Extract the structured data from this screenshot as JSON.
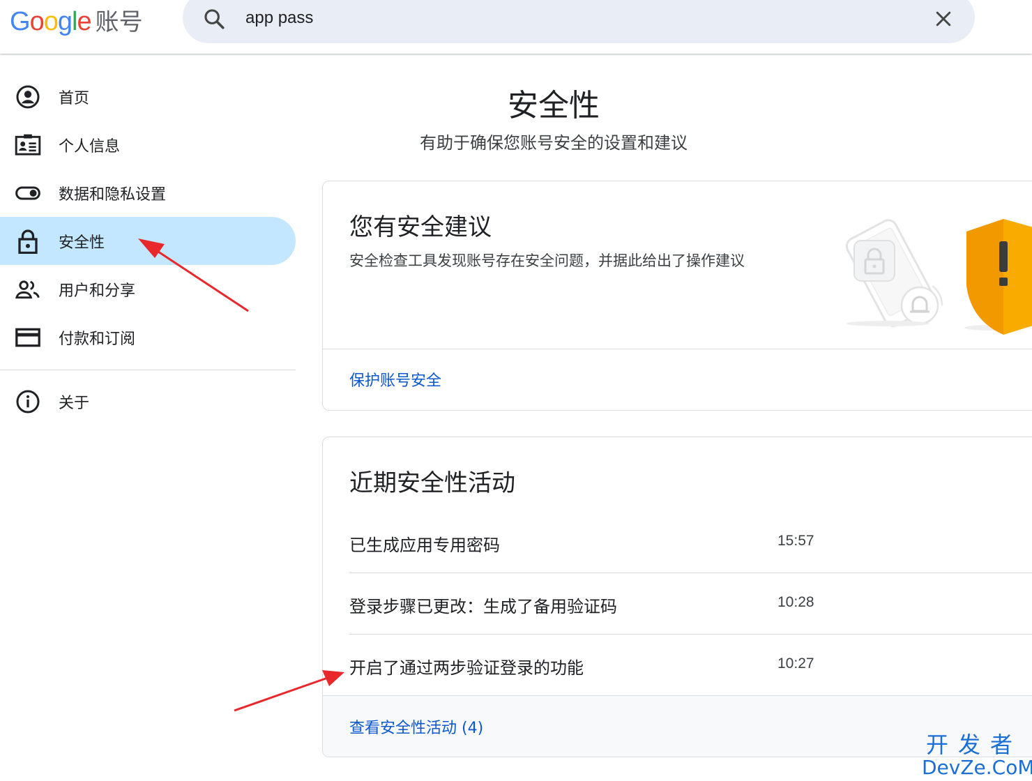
{
  "header": {
    "logo_letters": [
      {
        "char": "G",
        "color": "#4285F4"
      },
      {
        "char": "o",
        "color": "#EA4335"
      },
      {
        "char": "o",
        "color": "#FBBC05"
      },
      {
        "char": "g",
        "color": "#4285F4"
      },
      {
        "char": "l",
        "color": "#34A853"
      },
      {
        "char": "e",
        "color": "#EA4335"
      }
    ],
    "logo_suffix": "账号",
    "search": {
      "value": "app pass",
      "icon": "search-icon",
      "clear_icon": "close-icon"
    }
  },
  "sidebar": {
    "items": [
      {
        "label": "首页",
        "icon": "account-circle-icon",
        "active": false
      },
      {
        "label": "个人信息",
        "icon": "id-card-icon",
        "active": false
      },
      {
        "label": "数据和隐私设置",
        "icon": "toggle-icon",
        "active": false
      },
      {
        "label": "安全性",
        "icon": "lock-icon",
        "active": true
      },
      {
        "label": "用户和分享",
        "icon": "people-icon",
        "active": false
      },
      {
        "label": "付款和订阅",
        "icon": "credit-card-icon",
        "active": false
      }
    ],
    "secondary": [
      {
        "label": "关于",
        "icon": "info-icon"
      }
    ],
    "active_color": "#c2e7ff"
  },
  "main": {
    "title": "安全性",
    "subtitle": "有助于确保您账号安全的设置和建议",
    "recommendations_card": {
      "title": "您有安全建议",
      "description": "安全检查工具发现账号存在安全问题，并据此给出了操作建议",
      "link": "保护账号安全",
      "illustration_icons": [
        "phone-lock-icon",
        "bell-icon",
        "warning-shield-icon"
      ]
    },
    "activity_card": {
      "title": "近期安全性活动",
      "rows": [
        {
          "text": "已生成应用专用密码",
          "time": "15:57"
        },
        {
          "text": "登录步骤已更改：生成了备用验证码",
          "time": "10:28"
        },
        {
          "text": "开启了通过两步验证登录的功能",
          "time": "10:27"
        }
      ],
      "footer_link": "查看安全性活动 (4)"
    }
  },
  "colors": {
    "link": "#0b57d0",
    "annotation_arrow": "#e8282b",
    "shield": "#f29900"
  },
  "watermark": {
    "top": "开发者",
    "bottom": "DevZe.CoM"
  }
}
